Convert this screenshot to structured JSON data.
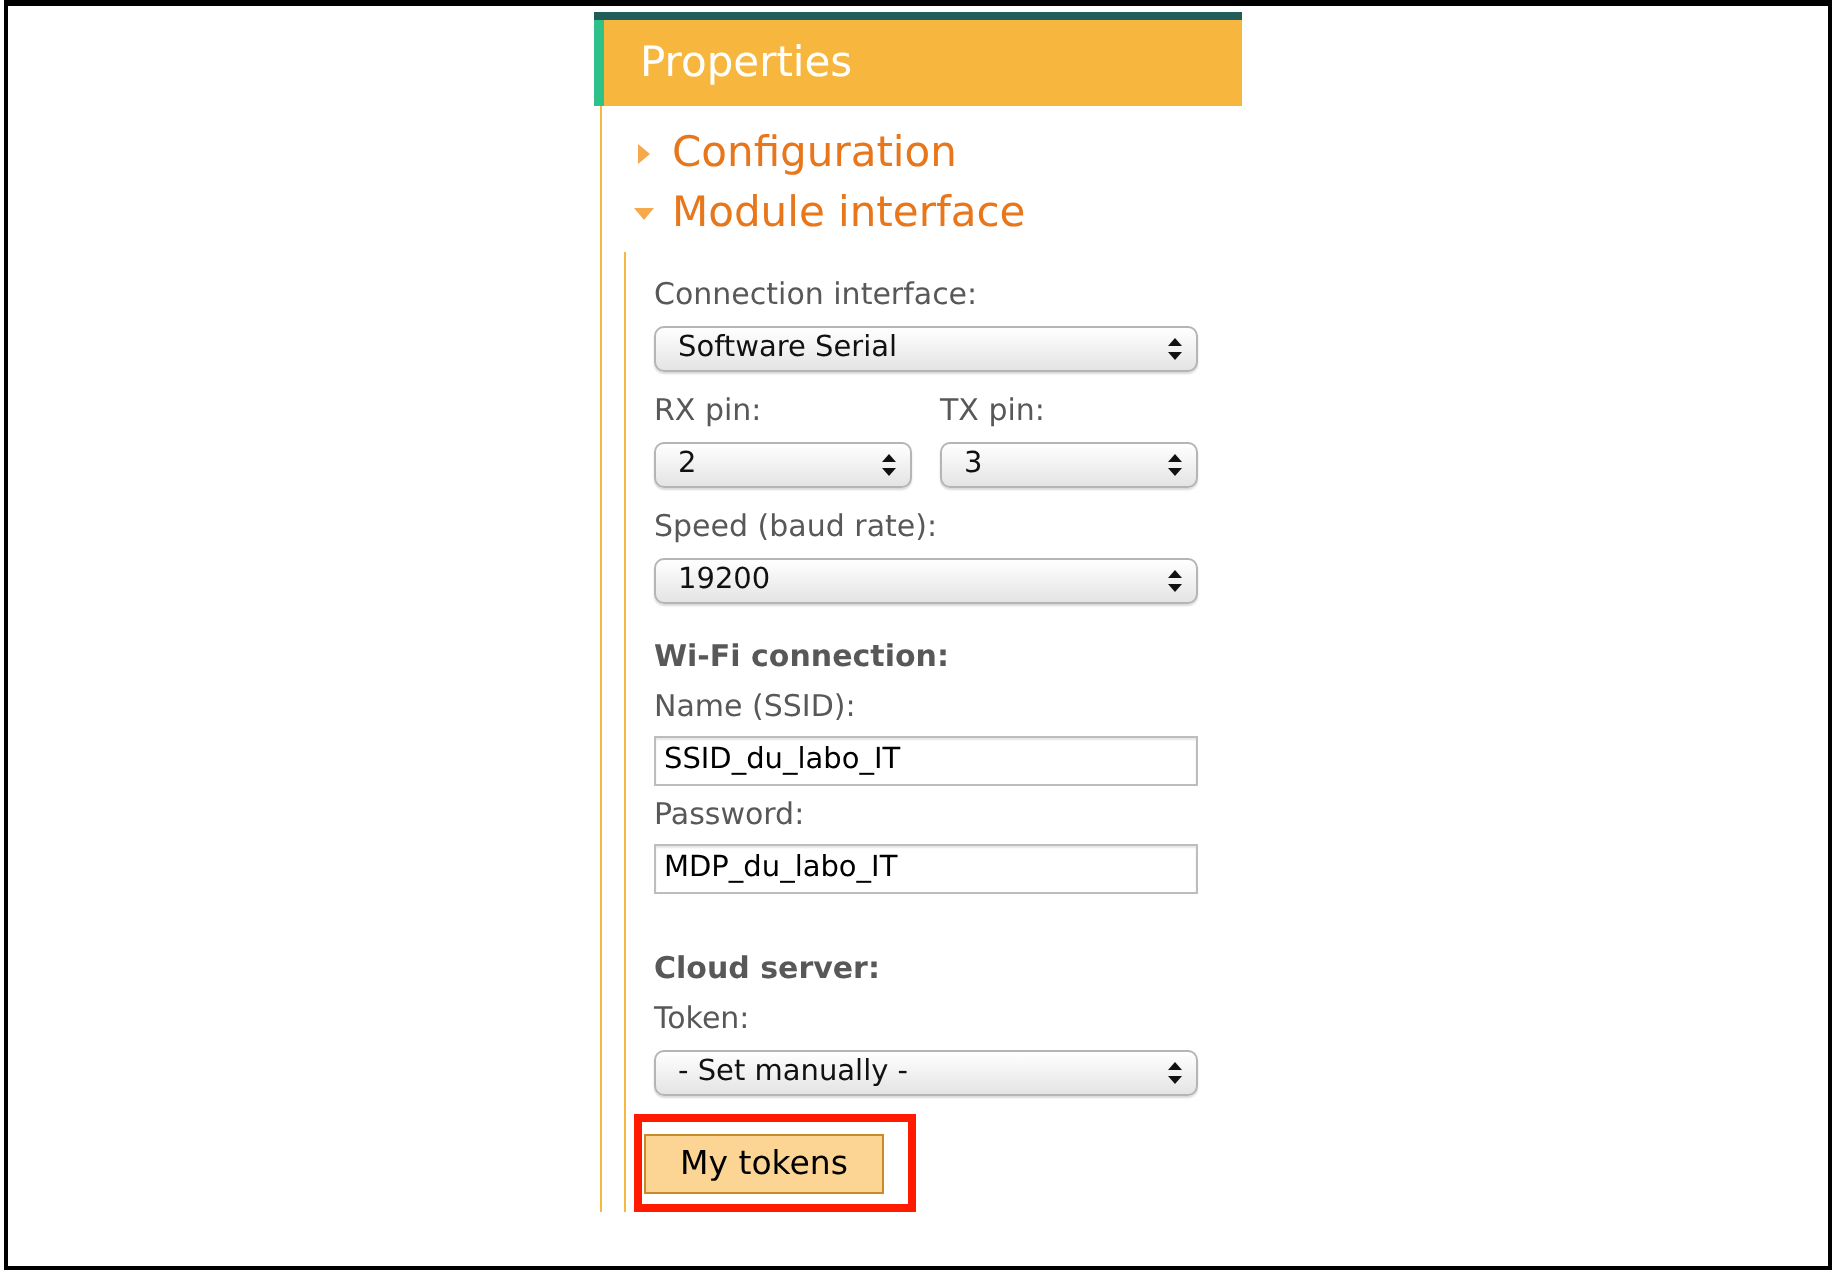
{
  "panel": {
    "title": "Properties"
  },
  "sections": [
    {
      "label": "Configuration",
      "expanded": false
    },
    {
      "label": "Module interface",
      "expanded": true
    }
  ],
  "fields": [
    {
      "kind": "select",
      "label": "Connection interface:",
      "value": "Software Serial"
    },
    {
      "kind": "select_pair",
      "items": [
        {
          "label": "RX pin:",
          "value": "2"
        },
        {
          "label": "TX pin:",
          "value": "3"
        }
      ]
    },
    {
      "kind": "select",
      "label": "Speed (baud rate):",
      "value": "19200"
    },
    {
      "kind": "heading",
      "text": "Wi-Fi connection:"
    },
    {
      "kind": "input",
      "label": "Name (SSID):",
      "value": "SSID_du_labo_IT"
    },
    {
      "kind": "input",
      "label": "Password:",
      "value": "MDP_du_labo_IT"
    },
    {
      "kind": "heading",
      "text": "Cloud server:"
    },
    {
      "kind": "select",
      "label": "Token:",
      "value": "- Set manually -"
    },
    {
      "kind": "button",
      "label": "My tokens",
      "highlighted": true
    }
  ]
}
